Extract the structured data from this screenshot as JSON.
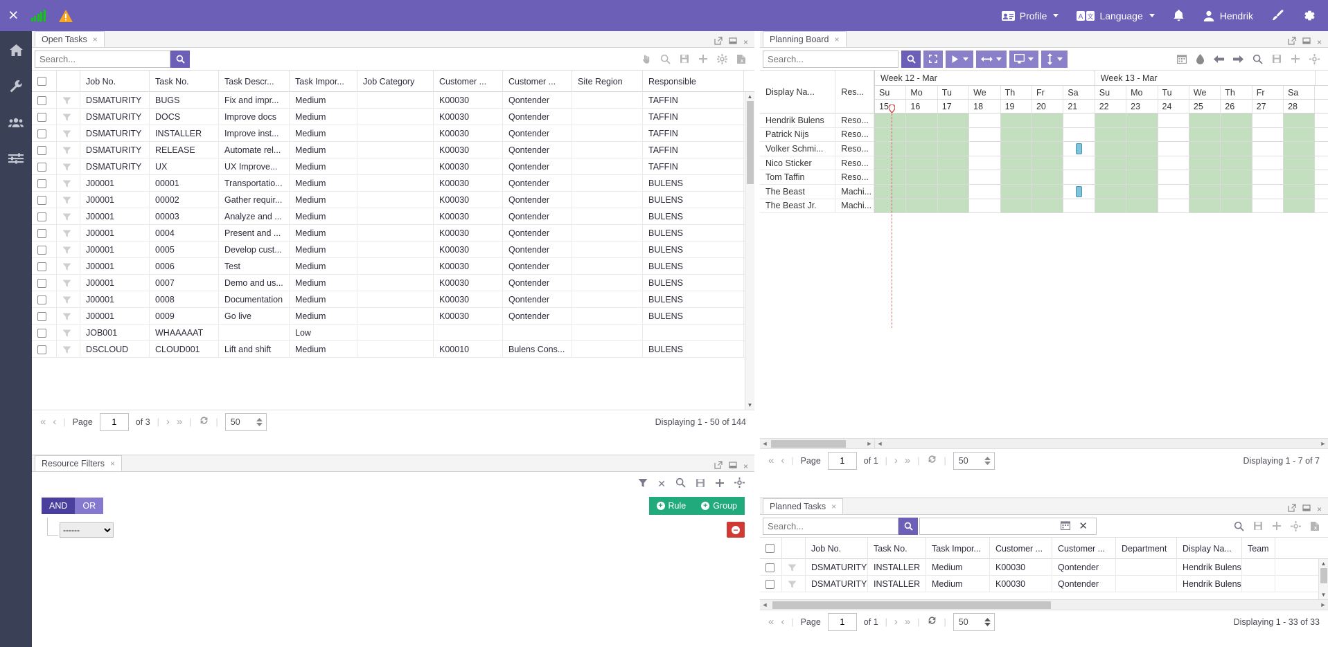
{
  "topbar": {
    "close_label": "×",
    "signal_icon": "signal-bars-icon",
    "warning_icon": "warning-triangle-icon",
    "profile_label": "Profile",
    "language_label": "Language",
    "notifications_icon": "bell-icon",
    "user_label": "Hendrik",
    "theme_icon": "paintbrush-icon",
    "settings_icon": "gear-icon",
    "accent": "#6C5FB8"
  },
  "rail": {
    "items": [
      {
        "name": "home-icon",
        "label": "Home"
      },
      {
        "name": "wrench-icon",
        "label": "Tools"
      },
      {
        "name": "users-icon",
        "label": "Resources"
      },
      {
        "name": "sliders-icon",
        "label": "Settings"
      }
    ]
  },
  "open_tasks": {
    "tab_label": "Open Tasks",
    "tab_close": "×",
    "window_tools": [
      "popout-icon",
      "minimize-icon",
      "close-icon"
    ],
    "search_value": "",
    "search_placeholder": "Search...",
    "search_button_icon": "search-icon",
    "toolbar_icons": [
      "hand-pointer-icon",
      "search-icon",
      "save-icon",
      "plus-icon",
      "gear-icon",
      "excel-export-icon"
    ],
    "columns": [
      "",
      "",
      "Job No.",
      "Task No.",
      "Task Descr...",
      "Task Impor...",
      "Job Category",
      "Customer ...",
      "Customer ...",
      "Site Region",
      "Responsible"
    ],
    "rows": [
      {
        "job": "DSMATURITY",
        "task": "BUGS",
        "descr": "Fix and impr...",
        "importance": "Medium",
        "category": "",
        "custno": "K00030",
        "custname": "Qontender",
        "region": "",
        "responsible": "TAFFIN"
      },
      {
        "job": "DSMATURITY",
        "task": "DOCS",
        "descr": "Improve docs",
        "importance": "Medium",
        "category": "",
        "custno": "K00030",
        "custname": "Qontender",
        "region": "",
        "responsible": "TAFFIN"
      },
      {
        "job": "DSMATURITY",
        "task": "INSTALLER",
        "descr": "Improve inst...",
        "importance": "Medium",
        "category": "",
        "custno": "K00030",
        "custname": "Qontender",
        "region": "",
        "responsible": "TAFFIN"
      },
      {
        "job": "DSMATURITY",
        "task": "RELEASE",
        "descr": "Automate rel...",
        "importance": "Medium",
        "category": "",
        "custno": "K00030",
        "custname": "Qontender",
        "region": "",
        "responsible": "TAFFIN"
      },
      {
        "job": "DSMATURITY",
        "task": "UX",
        "descr": "UX Improve...",
        "importance": "Medium",
        "category": "",
        "custno": "K00030",
        "custname": "Qontender",
        "region": "",
        "responsible": "TAFFIN"
      },
      {
        "job": "J00001",
        "task": "00001",
        "descr": "Transportatio...",
        "importance": "Medium",
        "category": "",
        "custno": "K00030",
        "custname": "Qontender",
        "region": "",
        "responsible": "BULENS"
      },
      {
        "job": "J00001",
        "task": "00002",
        "descr": "Gather requir...",
        "importance": "Medium",
        "category": "",
        "custno": "K00030",
        "custname": "Qontender",
        "region": "",
        "responsible": "BULENS"
      },
      {
        "job": "J00001",
        "task": "00003",
        "descr": "Analyze and ...",
        "importance": "Medium",
        "category": "",
        "custno": "K00030",
        "custname": "Qontender",
        "region": "",
        "responsible": "BULENS"
      },
      {
        "job": "J00001",
        "task": "0004",
        "descr": "Present and ...",
        "importance": "Medium",
        "category": "",
        "custno": "K00030",
        "custname": "Qontender",
        "region": "",
        "responsible": "BULENS"
      },
      {
        "job": "J00001",
        "task": "0005",
        "descr": "Develop cust...",
        "importance": "Medium",
        "category": "",
        "custno": "K00030",
        "custname": "Qontender",
        "region": "",
        "responsible": "BULENS"
      },
      {
        "job": "J00001",
        "task": "0006",
        "descr": "Test",
        "importance": "Medium",
        "category": "",
        "custno": "K00030",
        "custname": "Qontender",
        "region": "",
        "responsible": "BULENS"
      },
      {
        "job": "J00001",
        "task": "0007",
        "descr": "Demo and us...",
        "importance": "Medium",
        "category": "",
        "custno": "K00030",
        "custname": "Qontender",
        "region": "",
        "responsible": "BULENS"
      },
      {
        "job": "J00001",
        "task": "0008",
        "descr": "Documentation",
        "importance": "Medium",
        "category": "",
        "custno": "K00030",
        "custname": "Qontender",
        "region": "",
        "responsible": "BULENS"
      },
      {
        "job": "J00001",
        "task": "0009",
        "descr": "Go live",
        "importance": "Medium",
        "category": "",
        "custno": "K00030",
        "custname": "Qontender",
        "region": "",
        "responsible": "BULENS"
      },
      {
        "job": "JOB001",
        "task": "WHAAAAAT",
        "descr": "",
        "importance": "Low",
        "category": "",
        "custno": "",
        "custname": "",
        "region": "",
        "responsible": ""
      },
      {
        "job": "DSCLOUD",
        "task": "CLOUD001",
        "descr": "Lift and shift",
        "importance": "Medium",
        "category": "",
        "custno": "K00010",
        "custname": "Bulens Cons...",
        "region": "",
        "responsible": "BULENS"
      }
    ],
    "pager": {
      "page_label": "Page",
      "page_value": "1",
      "of_label": "of 3",
      "size_value": "50",
      "status": "Displaying 1 - 50 of 144"
    }
  },
  "resource_filters": {
    "tab_label": "Resource Filters",
    "tab_close": "×",
    "window_tools": [
      "popout-icon",
      "minimize-icon",
      "close-icon"
    ],
    "toolbar_icons": [
      "filter-icon",
      "clear-icon",
      "search-icon",
      "save-icon",
      "plus-icon",
      "gear-icon"
    ],
    "and_label": "AND",
    "or_label": "OR",
    "rule_label": "Rule",
    "group_label": "Group",
    "field_select_value": "------",
    "remove_label": "−"
  },
  "planning_board": {
    "tab_label": "Planning Board",
    "tab_close": "×",
    "window_tools": [
      "popout-icon",
      "minimize-icon",
      "close-icon"
    ],
    "search_value": "",
    "search_placeholder": "Search...",
    "search_button_icon": "search-icon",
    "toolbar_buttons": [
      {
        "icon": "search-icon",
        "name": "pb-search-button",
        "caret": false,
        "solid": true
      },
      {
        "icon": "fit-screen-icon",
        "name": "pb-fit-button",
        "caret": false,
        "solid": false
      },
      {
        "icon": "play-icon",
        "name": "pb-play-button",
        "caret": true,
        "solid": false
      },
      {
        "icon": "horizontal-arrows-icon",
        "name": "pb-horizontal-zoom-button",
        "caret": true,
        "solid": false
      },
      {
        "icon": "monitor-icon",
        "name": "pb-display-button",
        "caret": true,
        "solid": false
      },
      {
        "icon": "vertical-arrows-icon",
        "name": "pb-vertical-zoom-button",
        "caret": true,
        "solid": false
      }
    ],
    "right_icons": [
      "calendar-icon",
      "paint-drop-icon",
      "arrow-left-icon",
      "arrow-right-icon",
      "search-icon",
      "save-icon",
      "plus-icon",
      "gear-icon"
    ],
    "left_columns": [
      "Display Na...",
      "Res..."
    ],
    "weeks": [
      {
        "label": "Week 12 - Mar",
        "days": [
          {
            "dow": "Su",
            "dom": "15",
            "work": true
          },
          {
            "dow": "Mo",
            "dom": "16",
            "work": true
          },
          {
            "dow": "Tu",
            "dom": "17",
            "work": true
          },
          {
            "dow": "We",
            "dom": "18",
            "work": false
          },
          {
            "dow": "Th",
            "dom": "19",
            "work": true
          },
          {
            "dow": "Fr",
            "dom": "20",
            "work": true
          },
          {
            "dow": "Sa",
            "dom": "21",
            "work": false
          }
        ]
      },
      {
        "label": "Week 13 - Mar",
        "days": [
          {
            "dow": "Su",
            "dom": "22",
            "work": true
          },
          {
            "dow": "Mo",
            "dom": "23",
            "work": true
          },
          {
            "dow": "Tu",
            "dom": "24",
            "work": false
          },
          {
            "dow": "We",
            "dom": "25",
            "work": true
          },
          {
            "dow": "Th",
            "dom": "26",
            "work": true
          },
          {
            "dow": "Fr",
            "dom": "27",
            "work": false
          },
          {
            "dow": "Sa",
            "dom": "28",
            "work": true
          }
        ]
      }
    ],
    "resources": [
      {
        "display_name": "Hendrik Bulens",
        "type": "Reso...",
        "task_day": null
      },
      {
        "display_name": "Patrick Nijs",
        "type": "Reso...",
        "task_day": null
      },
      {
        "display_name": "Volker Schmi...",
        "type": "Reso...",
        "task_day": 6
      },
      {
        "display_name": "Nico Sticker",
        "type": "Reso...",
        "task_day": null
      },
      {
        "display_name": "Tom Taffin",
        "type": "Reso...",
        "task_day": null
      },
      {
        "display_name": "The Beast",
        "type": "Machi...",
        "task_day": 6
      },
      {
        "display_name": "The Beast Jr.",
        "type": "Machi...",
        "task_day": null
      }
    ],
    "today_marker": {
      "day_index": 0,
      "color": "#d24a4a"
    },
    "pager": {
      "page_label": "Page",
      "page_value": "1",
      "of_label": "of 1",
      "size_value": "50",
      "status": "Displaying 1 - 7 of 7"
    }
  },
  "planned_tasks": {
    "tab_label": "Planned Tasks",
    "tab_close": "×",
    "window_tools": [
      "popout-icon",
      "minimize-icon",
      "close-icon"
    ],
    "search_value": "",
    "search_placeholder": "Search...",
    "search_button_icon": "search-icon",
    "date_filter_value": "",
    "date_filter_icons": [
      "calendar-icon",
      "clear-icon"
    ],
    "toolbar_icons": [
      "search-icon",
      "save-icon",
      "plus-icon",
      "gear-icon",
      "excel-export-icon"
    ],
    "columns": [
      "",
      "",
      "Job No.",
      "Task No.",
      "Task Impor...",
      "Customer ...",
      "Customer ...",
      "Department",
      "Display Na...",
      "Team"
    ],
    "rows": [
      {
        "job": "DSMATURITY",
        "task": "INSTALLER",
        "importance": "Medium",
        "custno": "K00030",
        "custname": "Qontender",
        "department": "",
        "display_name": "Hendrik Bulens",
        "team": ""
      },
      {
        "job": "DSMATURITY",
        "task": "INSTALLER",
        "importance": "Medium",
        "custno": "K00030",
        "custname": "Qontender",
        "department": "",
        "display_name": "Hendrik Bulens",
        "team": ""
      }
    ],
    "pager": {
      "page_label": "Page",
      "page_value": "1",
      "of_label": "of 1",
      "size_value": "50",
      "status": "Displaying 1 - 33 of 33"
    }
  },
  "colors": {
    "accent": "#6C5FB8",
    "accent_light": "#8a7fc9",
    "rail": "#3A4055",
    "green": "#21ab7d",
    "red": "#cf3b34",
    "gantt_work": "#c4dfc0",
    "task_block": "#7fc4dd"
  }
}
